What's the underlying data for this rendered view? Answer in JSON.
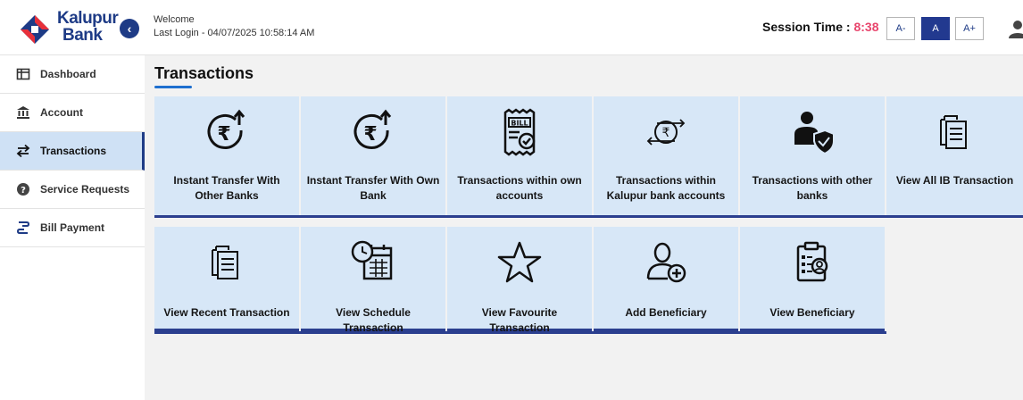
{
  "brand": {
    "name_line1": "Kalupur",
    "name_line2": "Bank",
    "primary_color": "#1e3b86",
    "accent_color": "#e8466d"
  },
  "header": {
    "welcome": "Welcome",
    "last_login": "Last Login - 04/07/2025 10:58:14 AM",
    "session_label": "Session Time :",
    "session_time": "8:38",
    "font_small": "A-",
    "font_normal": "A",
    "font_large": "A+",
    "collapse_icon": "chevron-left-icon",
    "user_icon": "user-icon"
  },
  "sidebar": {
    "items": [
      {
        "label": "Dashboard",
        "icon": "dashboard-icon",
        "active": false
      },
      {
        "label": "Account",
        "icon": "bank-building-icon",
        "active": false
      },
      {
        "label": "Transactions",
        "icon": "transfer-arrows-icon",
        "active": true
      },
      {
        "label": "Service Requests",
        "icon": "help-circle-icon",
        "active": false
      },
      {
        "label": "Bill Payment",
        "icon": "bill-payment-icon",
        "active": false
      }
    ]
  },
  "main": {
    "title": "Transactions",
    "tiles_row1": [
      {
        "label": "Instant Transfer With Other Banks",
        "icon": "rupee-up-arrow-icon"
      },
      {
        "label": "Instant Transfer With Own Bank",
        "icon": "rupee-up-arrow-icon"
      },
      {
        "label": "Transactions within own accounts",
        "icon": "bill-check-icon"
      },
      {
        "label": "Transactions within Kalupur bank accounts",
        "icon": "rupee-exchange-icon"
      },
      {
        "label": "Transactions with other banks",
        "icon": "person-shield-icon"
      },
      {
        "label": "View All IB Transaction",
        "icon": "documents-icon"
      }
    ],
    "tiles_row2": [
      {
        "label": "View Recent Transaction",
        "icon": "documents-icon"
      },
      {
        "label": "View Schedule Transaction",
        "icon": "calendar-clock-icon"
      },
      {
        "label": "View Favourite Transaction",
        "icon": "star-icon"
      },
      {
        "label": "Add Beneficiary",
        "icon": "add-user-icon"
      },
      {
        "label": "View Beneficiary",
        "icon": "clipboard-user-icon"
      }
    ]
  }
}
